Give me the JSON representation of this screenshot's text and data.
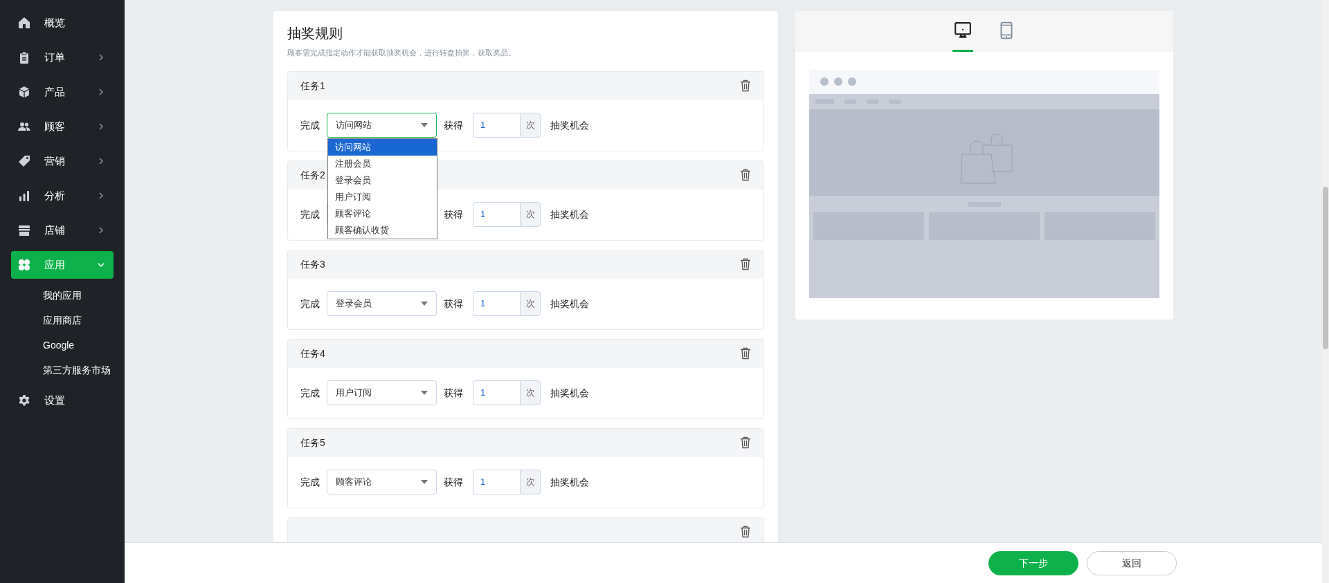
{
  "sidebar": {
    "items": [
      {
        "label": "概览",
        "kind": "link",
        "selected": false
      },
      {
        "label": "订单",
        "kind": "group",
        "expanded": false,
        "selected": false
      },
      {
        "label": "产品",
        "kind": "group",
        "expanded": false,
        "selected": false
      },
      {
        "label": "顾客",
        "kind": "group",
        "expanded": false,
        "selected": false
      },
      {
        "label": "营销",
        "kind": "group",
        "expanded": false,
        "selected": false
      },
      {
        "label": "分析",
        "kind": "group",
        "expanded": false,
        "selected": false
      },
      {
        "label": "店铺",
        "kind": "group",
        "expanded": false,
        "selected": false
      },
      {
        "label": "应用",
        "kind": "group",
        "expanded": true,
        "selected": true,
        "children": [
          {
            "label": "我的应用"
          },
          {
            "label": "应用商店"
          },
          {
            "label": "Google"
          },
          {
            "label": "第三方服务市场"
          }
        ]
      },
      {
        "label": "设置",
        "kind": "link",
        "selected": false
      }
    ]
  },
  "rules": {
    "title": "抽奖规则",
    "description": "顾客需完成指定动作才能获取抽奖机会，进行转盘抽奖，获取奖品。",
    "tasks": [
      {
        "label": "任务1",
        "complete_label": "完成",
        "action": "访问网站",
        "open": true,
        "options": [
          {
            "label": "访问网站",
            "selected": true
          },
          {
            "label": "注册会员",
            "selected": false
          },
          {
            "label": "登录会员",
            "selected": false
          },
          {
            "label": "用户订阅",
            "selected": false
          },
          {
            "label": "顾客评论",
            "selected": false
          },
          {
            "label": "顾客确认收货",
            "selected": false
          }
        ],
        "get_label": "获得",
        "count": "1",
        "unit": "次",
        "suffix": "抽奖机会"
      },
      {
        "label": "任务2",
        "complete_label": "完成",
        "open": false,
        "get_label": "获得",
        "count": "1",
        "unit": "次",
        "suffix": "抽奖机会"
      },
      {
        "label": "任务3",
        "complete_label": "完成",
        "action": "登录会员",
        "open": false,
        "get_label": "获得",
        "count": "1",
        "unit": "次",
        "suffix": "抽奖机会"
      },
      {
        "label": "任务4",
        "complete_label": "完成",
        "action": "用户订阅",
        "open": false,
        "get_label": "获得",
        "count": "1",
        "unit": "次",
        "suffix": "抽奖机会"
      },
      {
        "label": "任务5",
        "complete_label": "完成",
        "action": "顾客评论",
        "open": false,
        "get_label": "获得",
        "count": "1",
        "unit": "次",
        "suffix": "抽奖机会"
      }
    ],
    "more_below": true
  },
  "preview": {
    "tabs": [
      {
        "selected": true
      },
      {
        "selected": false
      }
    ]
  },
  "footer": {
    "buttons": [
      {
        "label": "下一步",
        "kind": "primary"
      },
      {
        "label": "返回",
        "kind": "secondary"
      }
    ]
  }
}
